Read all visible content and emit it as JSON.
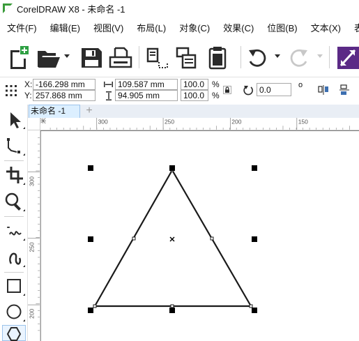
{
  "window": {
    "title": "CorelDRAW X8 - 未命名 -1"
  },
  "menu": [
    "文件(F)",
    "编辑(E)",
    "视图(V)",
    "布局(L)",
    "对象(C)",
    "效果(C)",
    "位图(B)",
    "文本(X)",
    "表格"
  ],
  "property_bar": {
    "x_label": "X:",
    "x_value": "-166.298 mm",
    "y_label": "Y:",
    "y_value": "257.868 mm",
    "width_value": "109.587 mm",
    "height_value": "94.905 mm",
    "scale_x": "100.0",
    "scale_y": "100.0",
    "percent": "%",
    "rotation": "0.0",
    "degree": "o"
  },
  "doc_tab": {
    "label": "未命名 -1",
    "add_symbol": "+"
  },
  "ruler": {
    "h_unit": "米",
    "h_labels": [
      "300",
      "250",
      "200",
      "150"
    ],
    "v_labels": [
      "300",
      "250",
      "200"
    ]
  },
  "colors": {
    "accent": "#3d6fb0",
    "tab_bg": "#dcefff",
    "effects_button": "#5b2a86",
    "logo": "#3a9b3a"
  },
  "icons": {
    "toolbar": [
      "new-document-icon",
      "open-folder-icon",
      "save-icon",
      "print-icon",
      "import-icon",
      "export-icon",
      "publish-pdf-icon",
      "undo-icon",
      "redo-icon",
      "effects-icon"
    ],
    "toolbox": [
      "pick-tool-icon",
      "shape-tool-icon",
      "crop-tool-icon",
      "zoom-tool-icon",
      "freehand-tool-icon",
      "artistic-media-icon",
      "rectangle-tool-icon",
      "ellipse-tool-icon",
      "polygon-tool-icon"
    ]
  }
}
